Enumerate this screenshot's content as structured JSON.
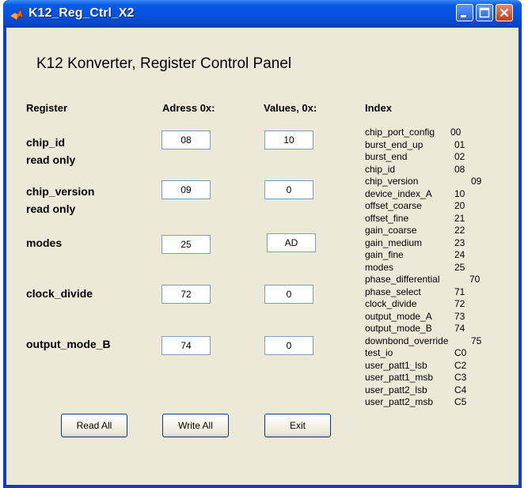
{
  "window": {
    "title": "K12_Reg_Ctrl_X2"
  },
  "panel": {
    "heading": "K12 Konverter, Register Control Panel",
    "columns": {
      "register": "Register",
      "address": "Adress 0x:",
      "values": "Values, 0x:",
      "index": "Index"
    }
  },
  "registers": [
    {
      "name": "chip_id",
      "note": "read only",
      "address": "08",
      "value": "10"
    },
    {
      "name": "chip_version",
      "note": "read only",
      "address": "09",
      "value": "0"
    },
    {
      "name": "modes",
      "note": "",
      "address": "25",
      "value": "AD"
    },
    {
      "name": "clock_divide",
      "note": "",
      "address": "72",
      "value": "0"
    },
    {
      "name": "output_mode_B",
      "note": "",
      "address": "74",
      "value": "0"
    }
  ],
  "buttons": {
    "read_all": "Read All",
    "write_all": "Write All",
    "exit": "Exit"
  },
  "index": [
    {
      "name": "chip_port_config",
      "code": "00"
    },
    {
      "name": "burst_end_up",
      "code": "01"
    },
    {
      "name": "burst_end",
      "code": "02"
    },
    {
      "name": "chip_id",
      "code": "08"
    },
    {
      "name": "chip_version",
      "code": "09"
    },
    {
      "name": "device_index_A",
      "code": "10"
    },
    {
      "name": "offset_coarse",
      "code": "20"
    },
    {
      "name": "offset_fine",
      "code": "21"
    },
    {
      "name": "gain_coarse",
      "code": "22"
    },
    {
      "name": "gain_medium",
      "code": "23"
    },
    {
      "name": "gain_fine",
      "code": "24"
    },
    {
      "name": "modes",
      "code": "25"
    },
    {
      "name": "phase_differential",
      "code": "70"
    },
    {
      "name": "phase_select",
      "code": "71"
    },
    {
      "name": "clock_divide",
      "code": "72"
    },
    {
      "name": "output_mode_A",
      "code": "73"
    },
    {
      "name": "output_mode_B",
      "code": "74"
    },
    {
      "name": "downbond_override",
      "code": "75"
    },
    {
      "name": "test_io",
      "code": "C0"
    },
    {
      "name": "user_patt1_lsb",
      "code": "C2"
    },
    {
      "name": "user_patt1_msb",
      "code": "C3"
    },
    {
      "name": "user_patt2_lsb",
      "code": "C4"
    },
    {
      "name": "user_patt2_msb",
      "code": "C5"
    }
  ]
}
